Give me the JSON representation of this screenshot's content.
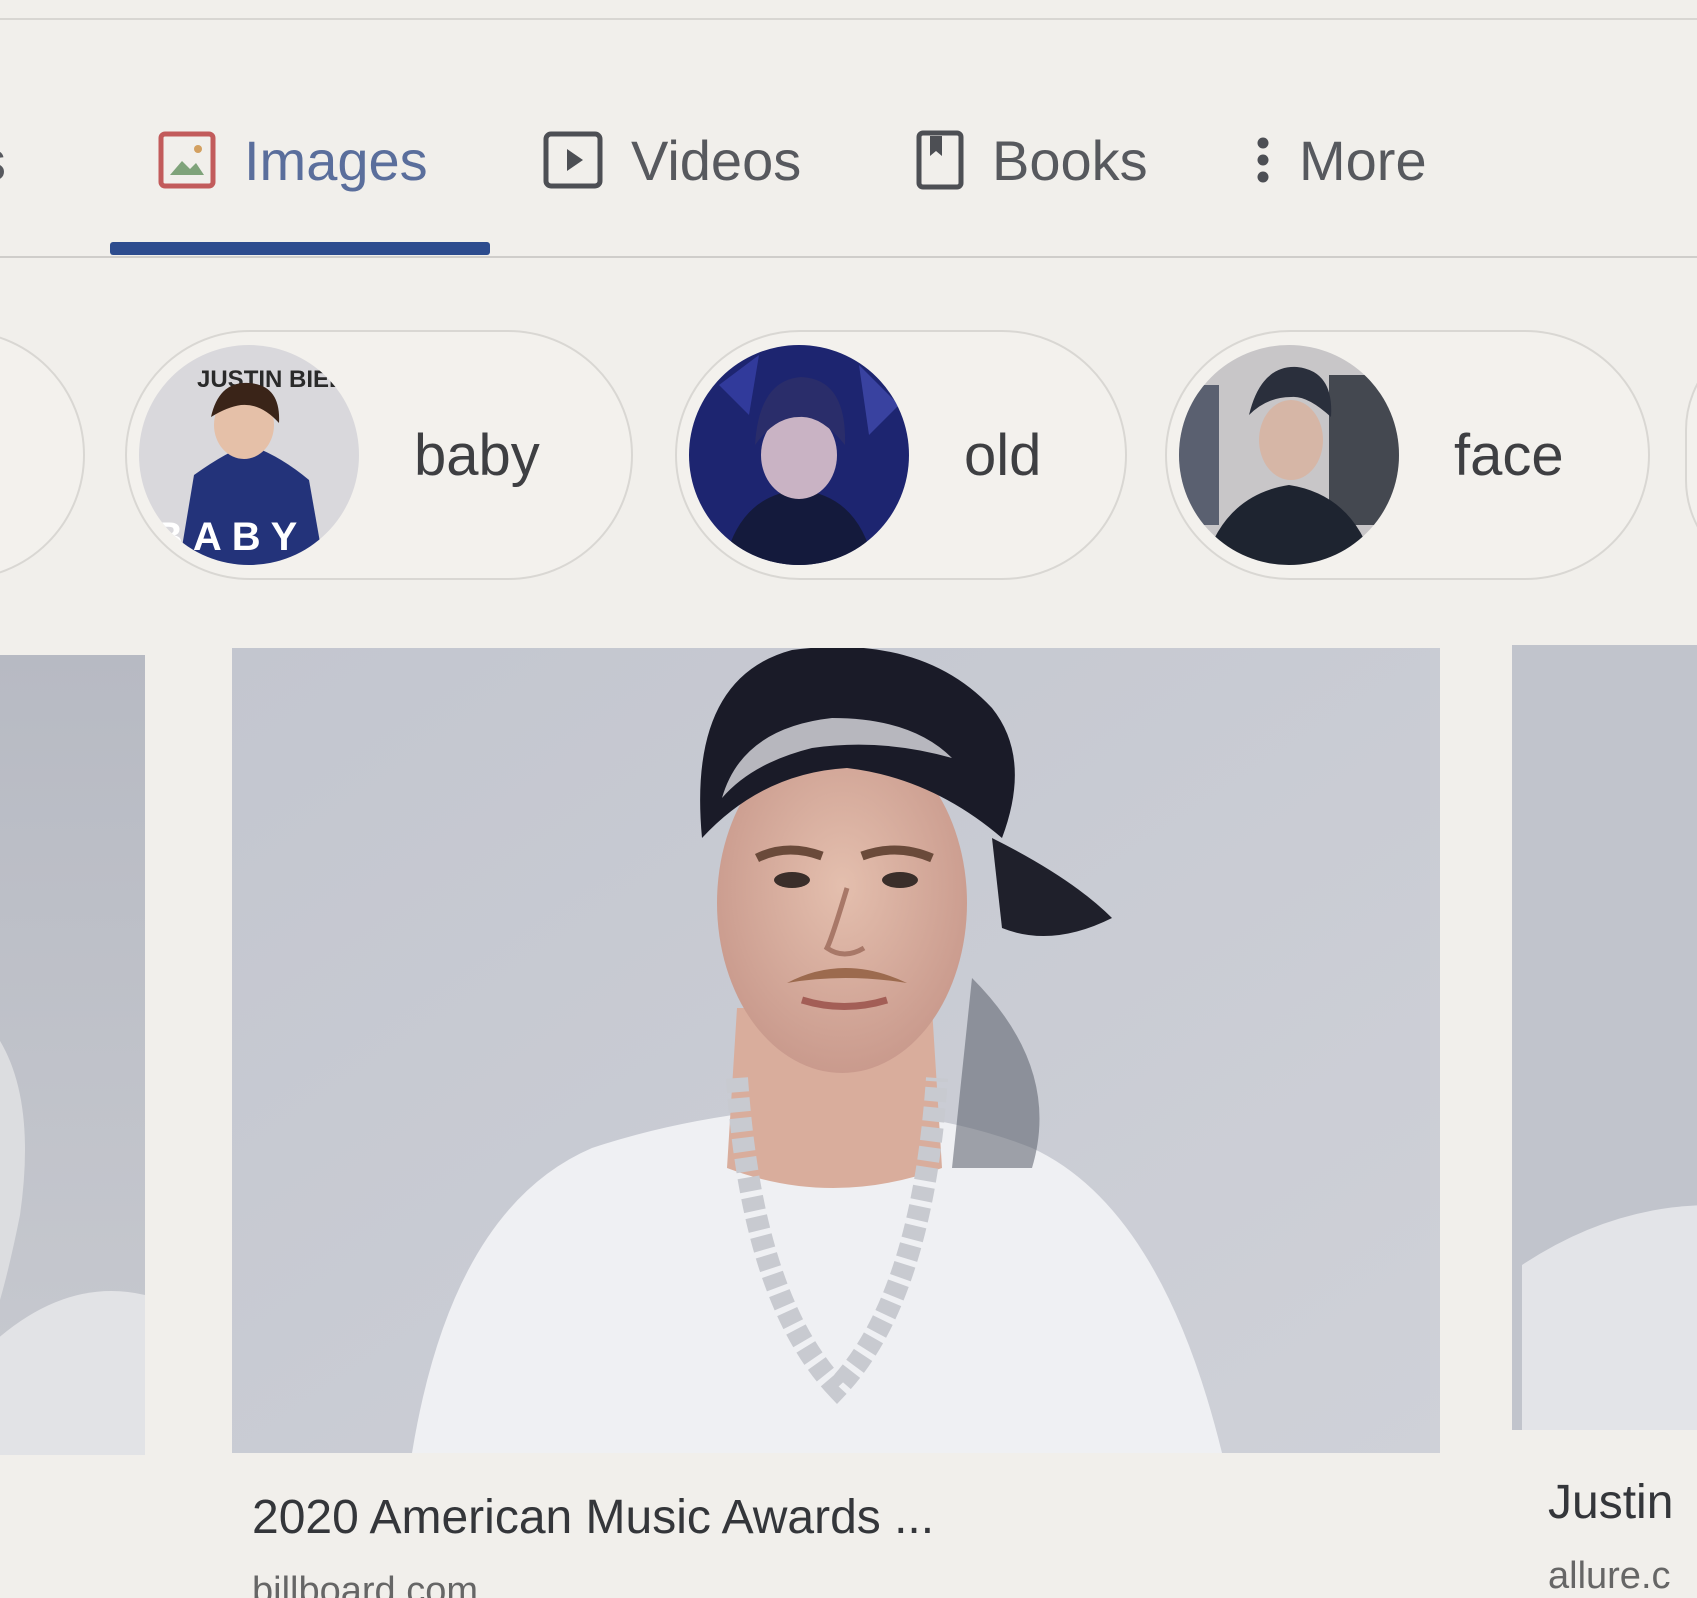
{
  "tabs": [
    {
      "label": "News",
      "visible_text": "vs",
      "icon": "news-icon"
    },
    {
      "label": "Images",
      "icon": "image-icon",
      "active": true
    },
    {
      "label": "Videos",
      "icon": "video-play-icon"
    },
    {
      "label": "Books",
      "icon": "book-icon"
    },
    {
      "label": "More",
      "icon": "more-vertical-icon"
    }
  ],
  "chips": [
    {
      "label": "baby",
      "thumb_text_top": "JUSTIN BIEBER",
      "thumb_text_bottom": "BABY"
    },
    {
      "label": "old"
    },
    {
      "label": "face"
    }
  ],
  "results": {
    "main": {
      "caption": "2020 American Music Awards ...",
      "source": "billboard.com"
    },
    "right": {
      "caption": "Justin",
      "source": "allure.c"
    }
  },
  "colors": {
    "background": "#f1efeb",
    "active_tab": "#5a6e9c",
    "tab_indicator": "#2d4c8e",
    "text": "#3e3f42"
  }
}
